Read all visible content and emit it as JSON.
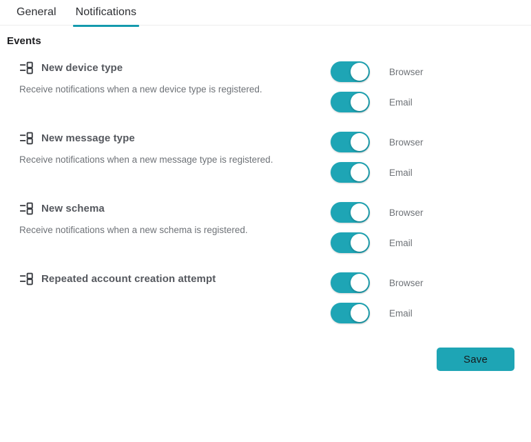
{
  "tabs": [
    {
      "label": "General",
      "active": false
    },
    {
      "label": "Notifications",
      "active": true
    }
  ],
  "section": {
    "title": "Events"
  },
  "events": [
    {
      "icon": "schema-icon",
      "name": "New device type",
      "description": "Receive notifications when a new device type is registered.",
      "channels": [
        {
          "label": "Browser",
          "state": "on"
        },
        {
          "label": "Email",
          "state": "on"
        }
      ]
    },
    {
      "icon": "schema-icon",
      "name": "New message type",
      "description": "Receive notifications when a new message type is registered.",
      "channels": [
        {
          "label": "Browser",
          "state": "on"
        },
        {
          "label": "Email",
          "state": "on"
        }
      ]
    },
    {
      "icon": "schema-icon",
      "name": "New schema",
      "description": "Receive notifications when a new schema is registered.",
      "channels": [
        {
          "label": "Browser",
          "state": "on"
        },
        {
          "label": "Email",
          "state": "on"
        }
      ]
    },
    {
      "icon": "schema-icon",
      "name": "Repeated account creation attempt",
      "description": "",
      "channels": [
        {
          "label": "Browser",
          "state": "on"
        },
        {
          "label": "Email",
          "state": "on"
        }
      ]
    }
  ],
  "footer": {
    "save_label": "Save"
  },
  "colors": {
    "accent": "#1ea5b5",
    "tab_underline": "#149aad",
    "heading_text": "#1c1d20",
    "event_name_text": "#55585e",
    "muted_text": "#6e7277",
    "divider": "#ececec"
  }
}
